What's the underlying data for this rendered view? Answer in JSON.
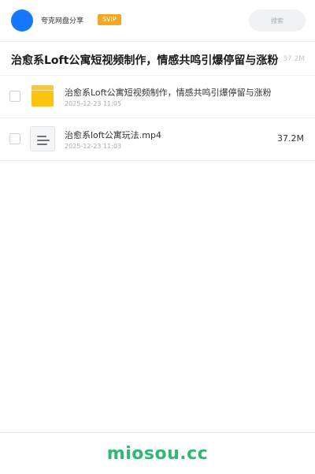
{
  "header": {
    "brand": "夸克网盘分享",
    "badge": "SVIP",
    "search_placeholder": "搜索",
    "accent_color": "#1677ff",
    "badge_color": "#f5a623"
  },
  "page": {
    "title": "治愈系Loft公寓短视频制作，情感共鸣引爆停留与涨粉",
    "title_size": "37.2M"
  },
  "files": [
    {
      "icon": "folder-icon",
      "name": "治愈系Loft公寓短视频制作，情感共鸣引爆停留与涨粉",
      "date": "2025-12-23 11:05",
      "size": ""
    },
    {
      "icon": "video-file-icon",
      "name": "治愈系loft公寓玩法.mp4",
      "date": "2025-12-23 11:03",
      "size": "37.2M"
    }
  ],
  "footer": {
    "logo": "miosou.cc",
    "logo_color": "#2eb872"
  }
}
